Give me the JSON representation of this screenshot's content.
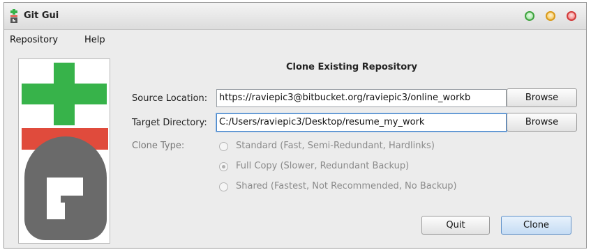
{
  "window": {
    "title": "Git Gui",
    "controls": [
      "maximize",
      "minimize",
      "close"
    ]
  },
  "menubar": {
    "items": [
      "Repository",
      "Help"
    ]
  },
  "dialog": {
    "heading": "Clone Existing Repository",
    "source_label": "Source Location:",
    "source_value": "https://raviepic3@bitbucket.org/raviepic3/online_workb",
    "target_label": "Target Directory:",
    "target_value": "C:/Users/raviepic3/Desktop/resume_my_work",
    "browse_label": "Browse",
    "clone_type_label": "Clone Type:",
    "clone_types": [
      {
        "label": "Standard (Fast, Semi-Redundant, Hardlinks)",
        "selected": false
      },
      {
        "label": "Full Copy (Slower, Redundant Backup)",
        "selected": true
      },
      {
        "label": "Shared (Fastest, Not Recommended, No Backup)",
        "selected": false
      }
    ],
    "quit_label": "Quit",
    "clone_label": "Clone"
  },
  "colors": {
    "logo_green": "#37b34a",
    "logo_red": "#e04b3c",
    "logo_gray": "#6a6a6a",
    "clone_button": "#c5dcf4"
  }
}
